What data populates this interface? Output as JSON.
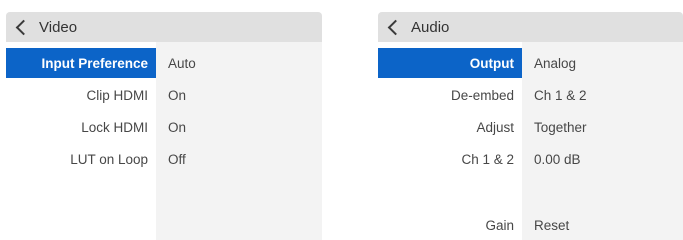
{
  "video_panel": {
    "title": "Video",
    "rows": [
      {
        "label": "Input Preference",
        "value": "Auto",
        "selected": true
      },
      {
        "label": "Clip HDMI",
        "value": "On",
        "selected": false
      },
      {
        "label": "Lock HDMI",
        "value": "On",
        "selected": false
      },
      {
        "label": "LUT on Loop",
        "value": "Off",
        "selected": false
      }
    ]
  },
  "audio_panel": {
    "title": "Audio",
    "rows": [
      {
        "label": "Output",
        "value": "Analog",
        "selected": true
      },
      {
        "label": "De-embed",
        "value": "Ch 1 & 2",
        "selected": false
      },
      {
        "label": "Adjust",
        "value": "Together",
        "selected": false
      },
      {
        "label": "Ch 1 & 2",
        "value": "0.00 dB",
        "selected": false
      },
      {
        "label": "Gain",
        "value": "Reset",
        "selected": false
      }
    ]
  },
  "colors": {
    "selection": "#0c64c8",
    "header": "#e0e0e0",
    "value_column": "#f3f3f3"
  },
  "icons": {
    "back": "chevron-left-icon"
  }
}
